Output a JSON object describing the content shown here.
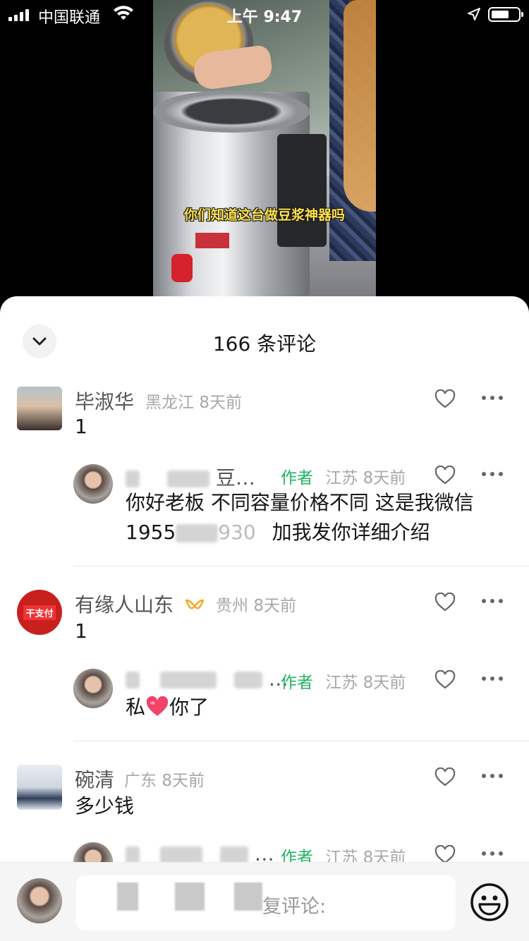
{
  "status_bar": {
    "carrier": "中国联通",
    "time": "上午 9:47"
  },
  "video": {
    "subtitle": "你们知道这台做豆浆神器吗"
  },
  "comments_sheet": {
    "title": "166 条评论",
    "comments": [
      {
        "name": "毕淑华",
        "location": "黑龙江",
        "time": "8天前",
        "text": "1",
        "reply": {
          "name_visible": "…",
          "name_suffix": "豆…",
          "author_tag": "作者",
          "location": "江苏",
          "time": "8天前",
          "text_line1": "你好老板 不同容量价格不同 这是我微信",
          "text_line2_prefix": "1955",
          "text_line2_middle": "930",
          "text_line2_suffix": "加我发你详细介绍"
        }
      },
      {
        "name": "有缘人山东",
        "location": "贵州",
        "time": "8天前",
        "text": "1",
        "avatar_text": "干支付",
        "reply": {
          "name_suffix": "…",
          "author_tag": "作者",
          "location": "江苏",
          "time": "8天前",
          "text_before": "私",
          "text_after": "你了"
        }
      },
      {
        "name": "碗清",
        "location": "广东",
        "time": "8天前",
        "text": "多少钱",
        "reply": {
          "name_suffix": "…",
          "author_tag": "作者",
          "location": "江苏",
          "time": "8天前"
        }
      }
    ]
  },
  "input_bar": {
    "placeholder_tail": "复评论:"
  },
  "colors": {
    "author_green": "#1fb462",
    "heart_emoji": "#f0436a"
  }
}
